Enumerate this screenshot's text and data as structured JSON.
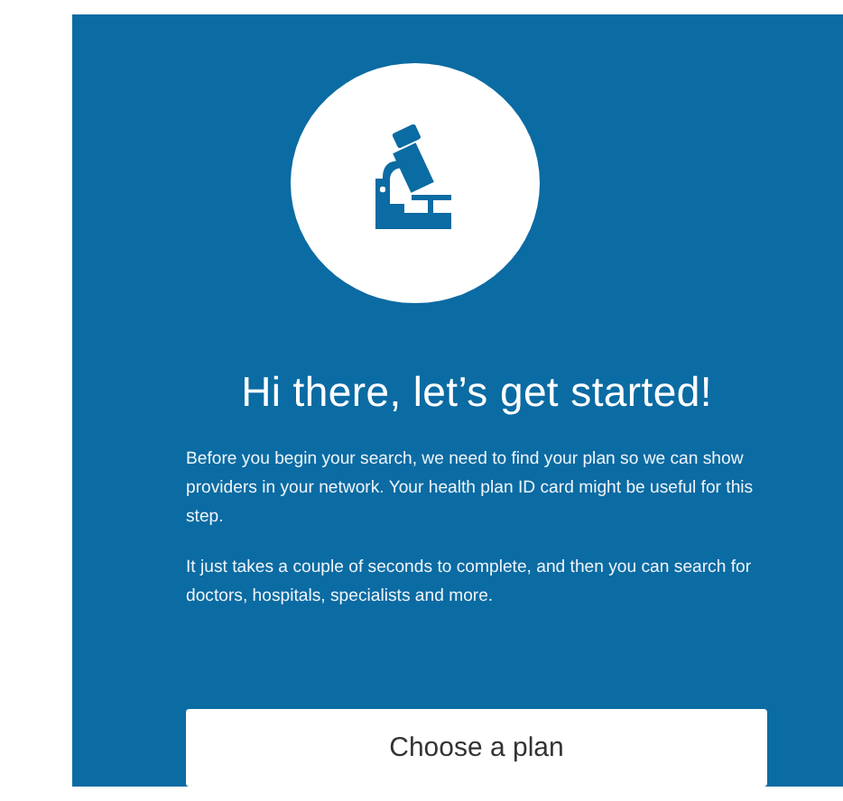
{
  "title": "Hi there, let’s get started!",
  "paragraphs": [
    "Before you begin your search, we need to find your plan so we can show providers in your network. Your health plan ID card might be useful for this step.",
    "It just takes a couple of seconds to complete, and then you can search for doctors, hospitals, specialists and more."
  ],
  "button": "Choose a plan"
}
